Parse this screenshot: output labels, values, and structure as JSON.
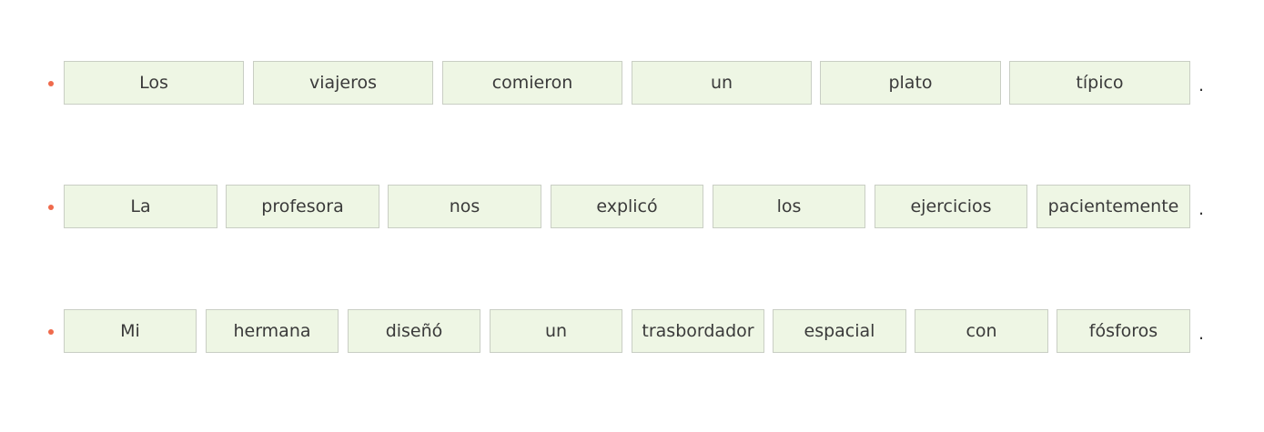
{
  "bullet_color": "#ef6a4c",
  "box_color": "#eef6e4",
  "sentences": [
    {
      "words": [
        "Los",
        "viajeros",
        "comieron",
        "un",
        "plato",
        "típico"
      ],
      "end": "."
    },
    {
      "words": [
        "La",
        "profesora",
        "nos",
        "explicó",
        "los",
        "ejercicios",
        "pacientemente"
      ],
      "end": "."
    },
    {
      "words": [
        "Mi",
        "hermana",
        "diseñó",
        "un",
        "trasbordador",
        "espacial",
        "con",
        "fósforos"
      ],
      "end": "."
    }
  ]
}
